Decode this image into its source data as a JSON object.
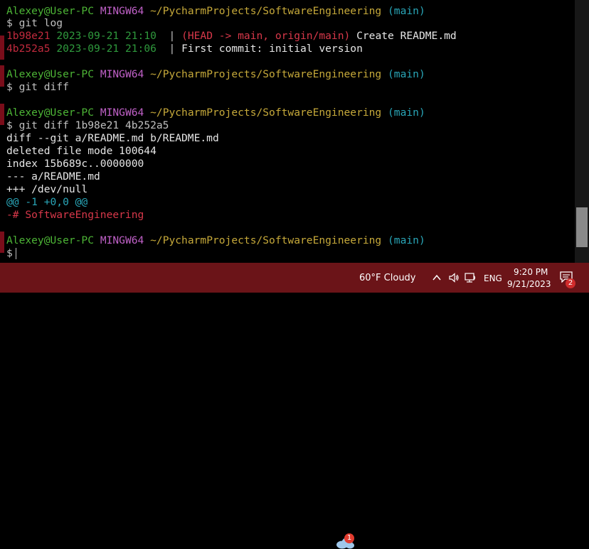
{
  "terminal": {
    "prompt": {
      "user": "Alexey@User-PC",
      "env": "MINGW64",
      "path": "~/PycharmProjects/SoftwareEngineering",
      "branch": "(main)",
      "symbol": "$"
    },
    "commands": {
      "log": "git log",
      "diff": "git diff",
      "diff_commits": "git diff 1b98e21 4b252a5"
    },
    "log_entries": [
      {
        "hash": "1b98e21",
        "date": "2023-09-21 21:10",
        "sep": "  | ",
        "refs": "(HEAD -> main, origin/main)",
        "message": "Create README.md"
      },
      {
        "hash": "4b252a5",
        "date": "2023-09-21 21:06",
        "sep": "  | ",
        "refs": "",
        "message": "First commit: initial version"
      }
    ],
    "diff_output": {
      "header": "diff --git a/README.md b/README.md",
      "mode": "deleted file mode 100644",
      "index": "index 15b689c..0000000",
      "old_file": "--- a/README.md",
      "new_file": "+++ /dev/null",
      "hunk": "@@ -1 +0,0 @@",
      "removed_line": "-# SoftwareEngineering"
    }
  },
  "taskbar": {
    "weather": {
      "temp": "60°F",
      "condition": "Cloudy",
      "badge": "1",
      "icon": "cloud-icon"
    },
    "tray": {
      "chevron": "^",
      "language": "ENG"
    },
    "clock": {
      "time": "9:20 PM",
      "date": "9/21/2023"
    },
    "notifications": {
      "count": "2"
    }
  }
}
